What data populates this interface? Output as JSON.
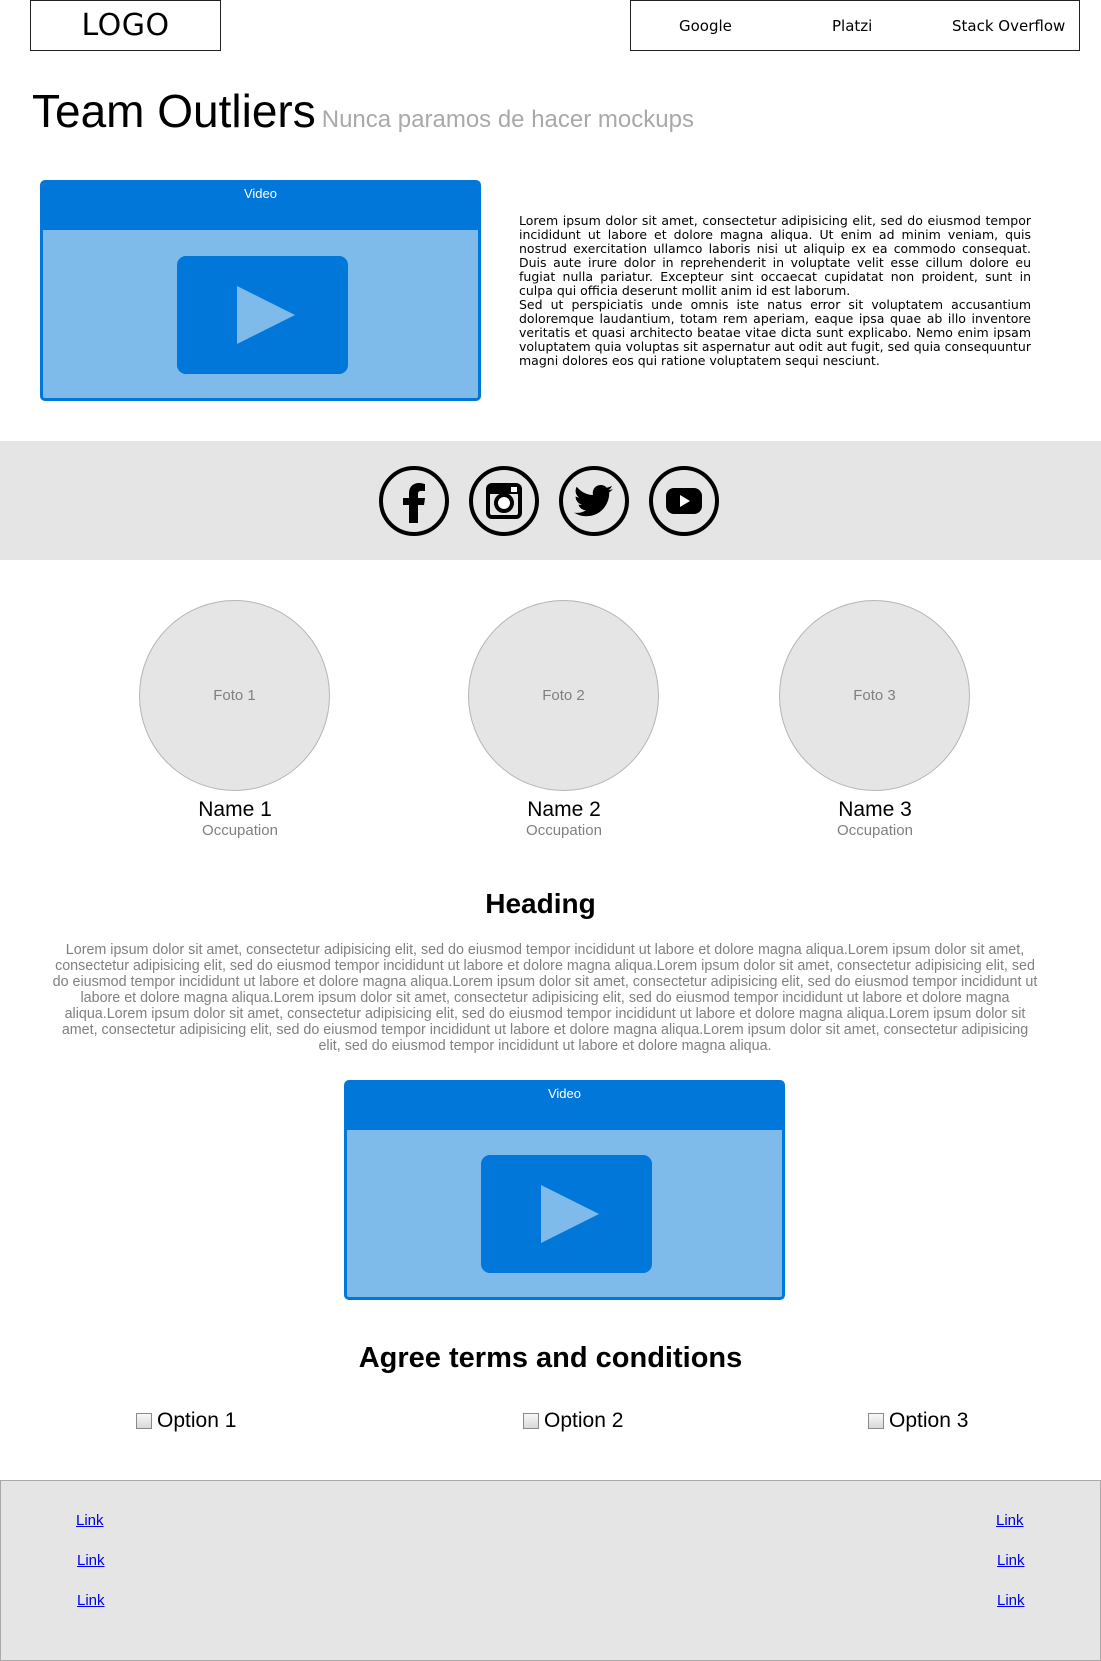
{
  "header": {
    "logo": "LOGO",
    "nav": [
      "Google",
      "Platzi",
      "Stack Overflow"
    ]
  },
  "hero": {
    "title": "Team Outliers",
    "subtitle": "Nunca paramos de hacer mockups",
    "video_label": "Video",
    "paragraphs": [
      "Lorem ipsum dolor sit amet, consectetur adipisicing elit, sed do eiusmod tempor incididunt ut labore et dolore magna aliqua. Ut enim ad minim veniam, quis nostrud exercitation ullamco laboris nisi ut aliquip ex ea commodo consequat. Duis aute irure dolor in reprehenderit in voluptate velit esse cillum dolore eu fugiat nulla pariatur. Excepteur sint occaecat cupidatat non proident, sunt in culpa qui officia deserunt mollit anim id est laborum.",
      "Sed ut perspiciatis unde omnis iste natus error sit voluptatem accusantium doloremque laudantium, totam rem aperiam, eaque ipsa quae ab illo inventore veritatis et quasi architecto beatae vitae dicta sunt explicabo. Nemo enim ipsam voluptatem quia voluptas sit aspernatur aut odit aut fugit, sed quia consequuntur magni dolores eos qui ratione voluptatem sequi nesciunt."
    ]
  },
  "social": [
    "facebook-icon",
    "instagram-icon",
    "twitter-icon",
    "youtube-icon"
  ],
  "team": [
    {
      "photo": "Foto 1",
      "name": "Name 1",
      "occupation": "Occupation"
    },
    {
      "photo": "Foto 2",
      "name": "Name 2",
      "occupation": "Occupation"
    },
    {
      "photo": "Foto 3",
      "name": "Name 3",
      "occupation": "Occupation"
    }
  ],
  "section": {
    "heading": "Heading",
    "body": "Lorem ipsum dolor sit amet, consectetur adipisicing elit, sed do eiusmod tempor incididunt ut labore et dolore magna aliqua.Lorem ipsum dolor sit amet, consectetur adipisicing elit, sed do eiusmod tempor incididunt ut labore et dolore magna aliqua.Lorem ipsum dolor sit amet, consectetur adipisicing elit, sed do eiusmod tempor incididunt ut labore et dolore magna aliqua.Lorem ipsum dolor sit amet, consectetur adipisicing elit, sed do eiusmod tempor incididunt ut labore et dolore magna aliqua.Lorem ipsum dolor sit amet, consectetur adipisicing elit, sed do eiusmod tempor incididunt ut labore et dolore magna aliqua.Lorem ipsum dolor sit amet, consectetur adipisicing elit, sed do eiusmod tempor incididunt ut labore et dolore magna aliqua.Lorem ipsum dolor sit amet, consectetur adipisicing elit, sed do eiusmod tempor incididunt ut labore et dolore magna aliqua.Lorem ipsum dolor sit amet, consectetur adipisicing elit, sed do eiusmod tempor incididunt ut labore et dolore magna aliqua.",
    "video_label": "Video"
  },
  "terms": {
    "heading": "Agree terms and conditions",
    "options": [
      "Option 1",
      "Option 2",
      "Option 3"
    ]
  },
  "footer": {
    "left_links": [
      "Link",
      "Link",
      "Link"
    ],
    "right_links": [
      "Link",
      "Link",
      "Link"
    ]
  },
  "colors": {
    "video_blue": "#0077d9",
    "video_light": "#7fbbea",
    "band_gray": "#e5e5e5",
    "link_blue": "#0000ee"
  }
}
